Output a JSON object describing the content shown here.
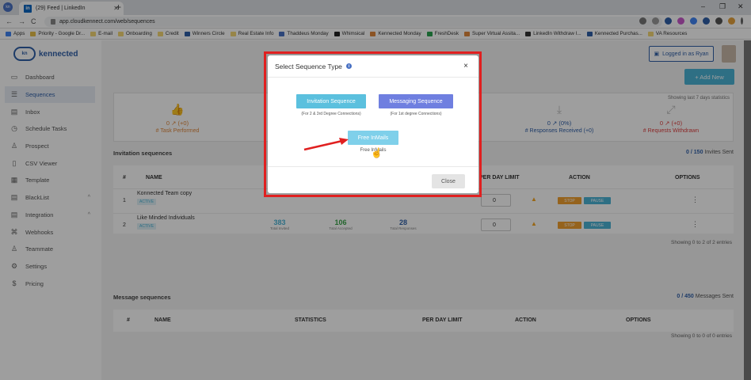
{
  "browser": {
    "tab_title": "(29) Feed | LinkedIn",
    "tab_favicon": "in",
    "url": "app.cloudkennect.com/web/sequences",
    "bookmarks": [
      "Apps",
      "Priority - Google Dr...",
      "E-mail",
      "Onboarding",
      "Credit",
      "Winners Circle",
      "Real Estate Info",
      "Thaddeus Monday",
      "Whimsical",
      "Kennected Monday",
      "FreshDesk",
      "Super Virtual Assita...",
      "LinkedIn Withdraw I...",
      "Kennected Purchas...",
      "VA Resources"
    ]
  },
  "app": {
    "logo_text": "kennected",
    "logo_mark": "kn",
    "logged_in": "Logged in as Ryan",
    "add_new": "+ Add New",
    "sidebar": [
      {
        "label": "Dashboard",
        "icon": "monitor-icon"
      },
      {
        "label": "Sequences",
        "icon": "list-icon"
      },
      {
        "label": "Inbox",
        "icon": "inbox-icon"
      },
      {
        "label": "Schedule Tasks",
        "icon": "clock-icon"
      },
      {
        "label": "Prospect",
        "icon": "user-icon"
      },
      {
        "label": "CSV Viewer",
        "icon": "file-icon"
      },
      {
        "label": "Template",
        "icon": "template-icon"
      },
      {
        "label": "BlackList",
        "icon": "blacklist-icon"
      },
      {
        "label": "Integration",
        "icon": "integration-icon"
      },
      {
        "label": "Webhooks",
        "icon": "webhook-icon"
      },
      {
        "label": "Teammate",
        "icon": "team-icon"
      },
      {
        "label": "Settings",
        "icon": "gear-icon"
      },
      {
        "label": "Pricing",
        "icon": "dollar-icon"
      }
    ],
    "stats": {
      "showing": "Showing last 7 days statistics",
      "task_value": "0",
      "task_delta": "(+0)",
      "task_label": "# Task Performed",
      "resp_value": "0",
      "resp_delta": "(0%)",
      "resp_label": "# Responses Received (+0)",
      "withdrawn_value": "0",
      "withdrawn_delta": "(+0)",
      "withdrawn_label": "# Requests Withdrawn"
    },
    "invitation": {
      "title": "Invitation sequences",
      "count": "0",
      "count_total": " / 150",
      "count_label": "Invites Sent",
      "headers": {
        "num": "#",
        "name": "NAME",
        "limit": "PER DAY LIMIT",
        "action": "ACTION",
        "options": "OPTIONS"
      },
      "rows": [
        {
          "num": "1",
          "name": "Konnected Team copy",
          "status": "ACTIVE",
          "limit": "0"
        },
        {
          "num": "2",
          "name": "Like Minded Individuals",
          "status": "ACTIVE",
          "invited": "383",
          "accepted": "106",
          "responses": "28",
          "limit": "0"
        }
      ],
      "stat_labels": {
        "invited": "Total Invited",
        "accepted": "Total Accepted",
        "responses": "Total Responses"
      },
      "stop": "STOP",
      "pause": "PAUSE",
      "footer": "Showing 0 to 2 of 2 entries"
    },
    "message": {
      "title": "Message sequences",
      "count": "0",
      "count_total": " / 450",
      "count_label": "Messages Sent",
      "headers": {
        "num": "#",
        "name": "NAME",
        "stats": "STATISTICS",
        "limit": "PER DAY LIMIT",
        "action": "ACTION",
        "options": "OPTIONS"
      },
      "footer": "Showing 0 to 0 of 0 entries"
    }
  },
  "modal": {
    "title": "Select Sequence Type",
    "close_x": "×",
    "invitation_btn": "Invitation Sequence",
    "invitation_desc": "(For 2 & 3rd Degree Connections)",
    "messaging_btn": "Messaging Sequence",
    "messaging_desc": "(For 1st degree Connections)",
    "inmails_btn": "Free InMails",
    "inmails_desc": "Free InMails",
    "close_btn": "Close"
  },
  "colors": {
    "invitation_btn": "#5bc0de",
    "messaging_btn": "#6f7fe0",
    "inmails_btn": "#7fd0ea",
    "highlight": "#e02020",
    "brand": "#2f5fa8"
  }
}
